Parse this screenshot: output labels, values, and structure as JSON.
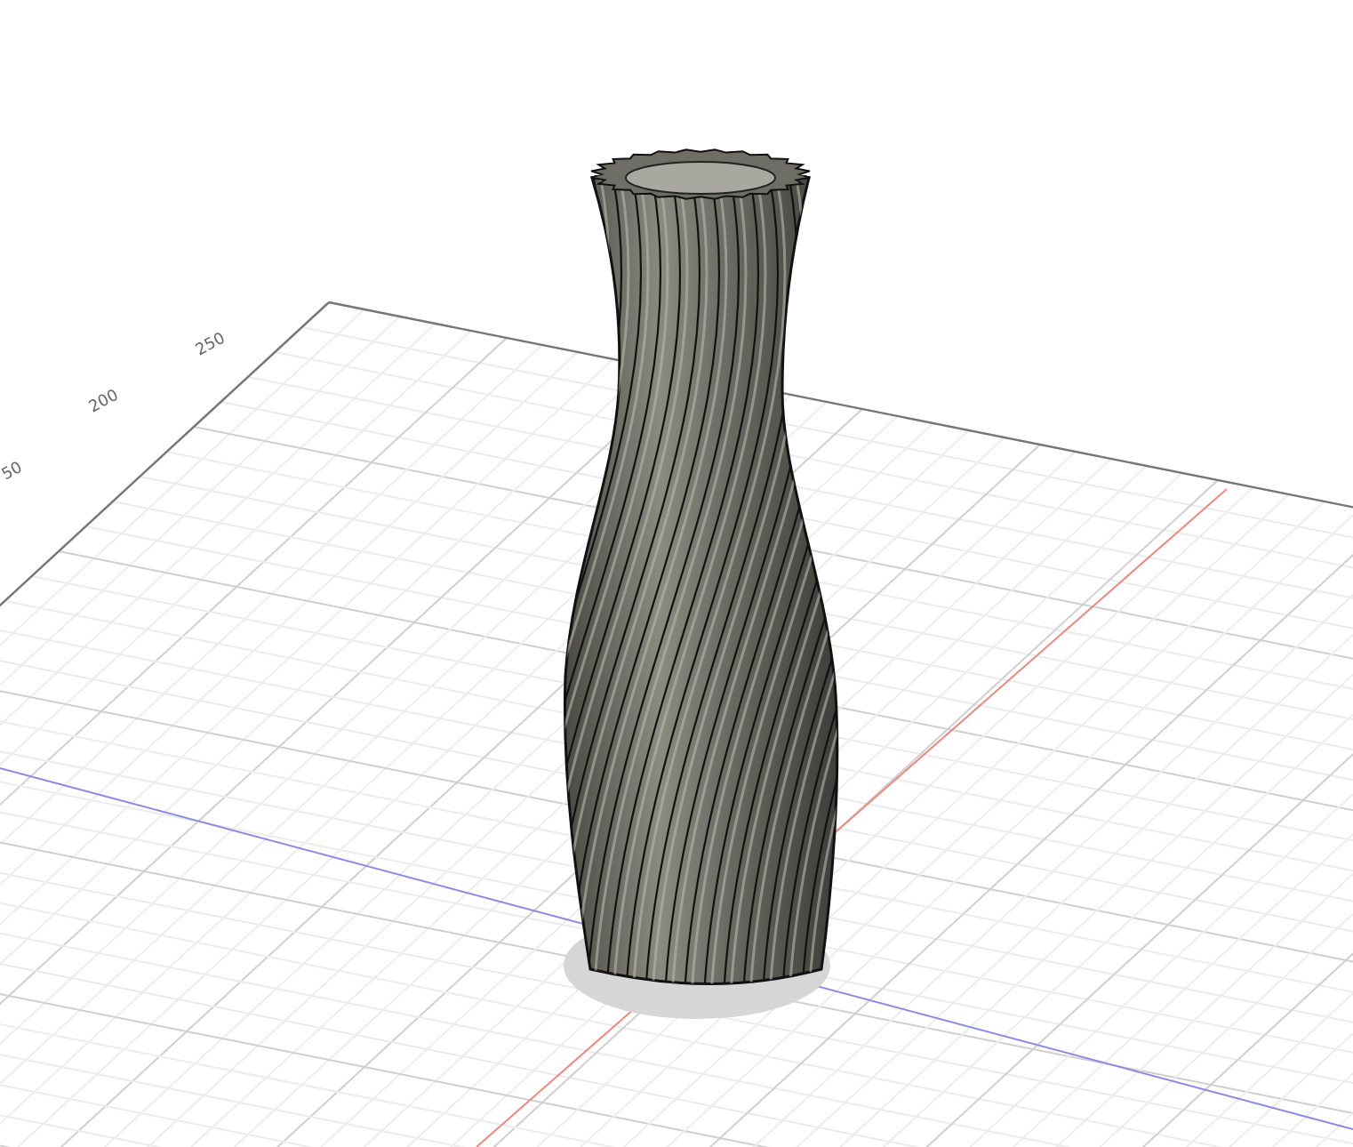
{
  "viewport": {
    "grid_labels": [
      {
        "text": "250"
      },
      {
        "text": "200"
      },
      {
        "text": "50"
      }
    ]
  }
}
